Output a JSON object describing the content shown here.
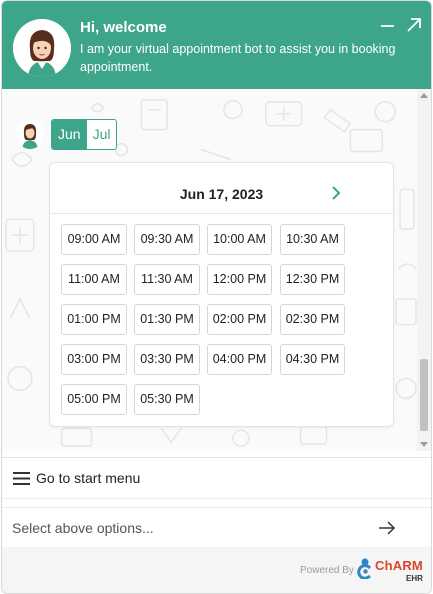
{
  "header": {
    "title": "Hi, welcome",
    "subtitle": "I am your virtual appointment bot to assist you in booking appointment.",
    "minimize_icon": "minimize-icon",
    "expand_icon": "expand-icon",
    "accent_color": "#3da58a"
  },
  "month_tabs": [
    {
      "label": "Jun",
      "active": true
    },
    {
      "label": "Jul",
      "active": false
    }
  ],
  "calendar": {
    "date": "Jun 17, 2023",
    "next_icon": "chevron-right-icon",
    "slots": [
      "09:00 AM",
      "09:30 AM",
      "10:00 AM",
      "10:30 AM",
      "11:00 AM",
      "11:30 AM",
      "12:00 PM",
      "12:30 PM",
      "01:00 PM",
      "01:30 PM",
      "02:00 PM",
      "02:30 PM",
      "03:00 PM",
      "03:30 PM",
      "04:00 PM",
      "04:30 PM",
      "05:00 PM",
      "05:30 PM"
    ]
  },
  "menu": {
    "label": "Go to start menu",
    "icon": "hamburger-icon"
  },
  "input": {
    "placeholder": "Select above options...",
    "send_icon": "arrow-right-icon"
  },
  "footer": {
    "powered_by": "Powered By",
    "brand": "ChARM",
    "brand_sub": "EHR",
    "brand_color": "#d8462a"
  }
}
